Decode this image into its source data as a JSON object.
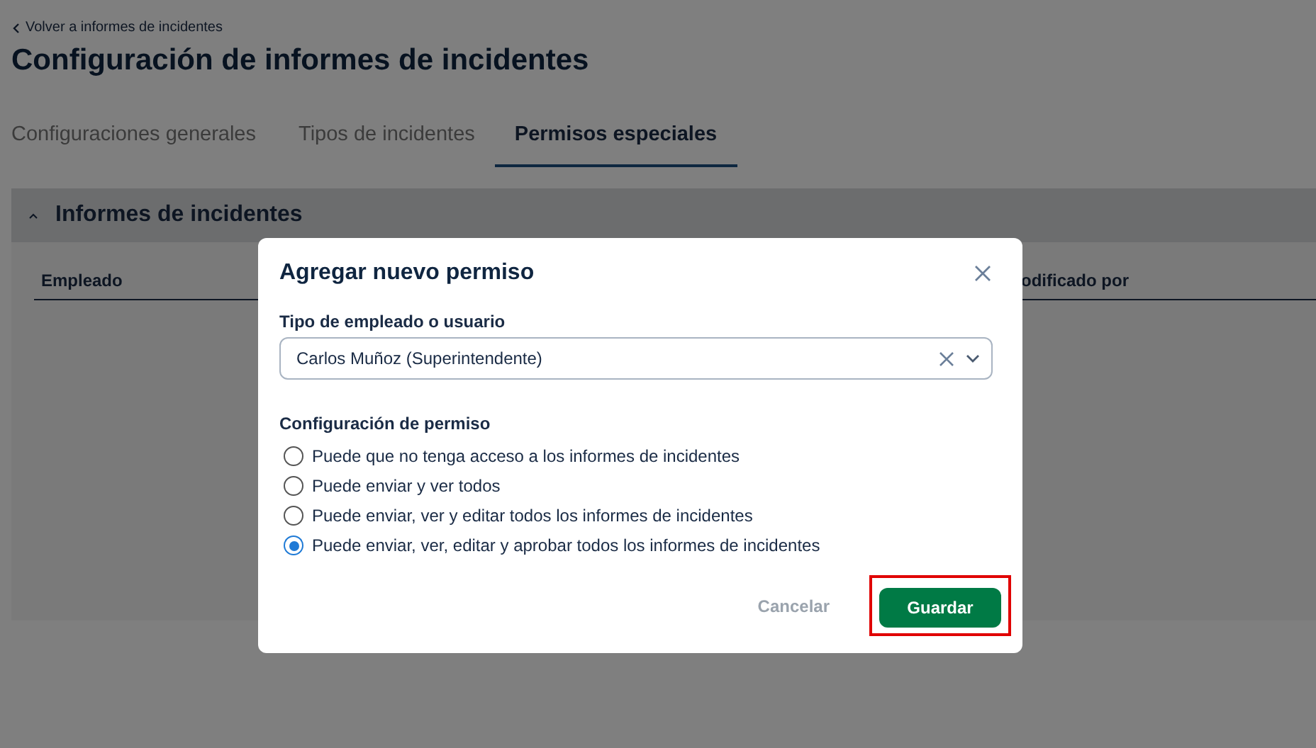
{
  "back_link": "Volver a informes de incidentes",
  "title": "Configuración de informes de incidentes",
  "tabs": [
    {
      "label": "Configuraciones generales",
      "selected": false
    },
    {
      "label": "Tipos de incidentes",
      "selected": false
    },
    {
      "label": "Permisos especiales",
      "selected": true
    }
  ],
  "section": {
    "title": "Informes de incidentes",
    "expanded": true,
    "columns": [
      "Empleado",
      "odificado por"
    ]
  },
  "dialog": {
    "title": "Agregar nuevo permiso",
    "field_label": "Tipo de empleado o usuario",
    "field_value": "Carlos Muñoz (Superintendente)",
    "group_label": "Configuración de permiso",
    "options": [
      {
        "label": "Puede que no tenga acceso a los informes de incidentes",
        "selected": false
      },
      {
        "label": "Puede enviar y ver todos",
        "selected": false
      },
      {
        "label": "Puede enviar, ver y editar todos los informes de incidentes",
        "selected": false
      },
      {
        "label": "Puede enviar, ver, editar y aprobar todos los informes de incidentes",
        "selected": true
      }
    ],
    "cancel": "Cancelar",
    "save": "Guardar",
    "save_highlighted": true
  }
}
